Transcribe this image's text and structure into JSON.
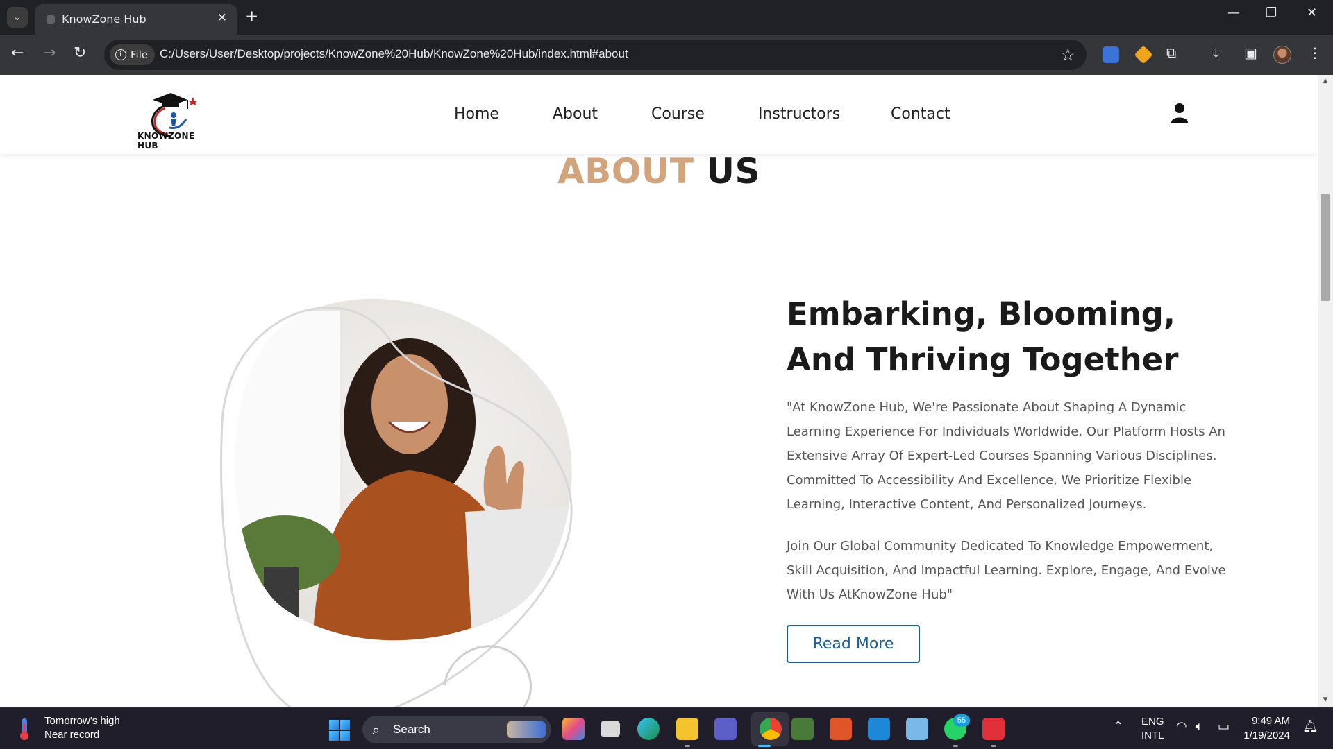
{
  "browser": {
    "tab_title": "KnowZone Hub",
    "chip_label": "File",
    "url": "C:/Users/User/Desktop/projects/KnowZone%20Hub/KnowZone%20Hub/index.html#about",
    "controls": {
      "minimize": "—",
      "maximize": "❐",
      "close": "✕",
      "new_tab": "+",
      "tab_close": "✕"
    }
  },
  "site": {
    "logo_text": "KNOWZONE HUB",
    "nav": [
      "Home",
      "About",
      "Course",
      "Instructors",
      "Contact"
    ],
    "icons": {
      "user": "user-icon"
    }
  },
  "about": {
    "title_accent": "ABOUT",
    "title_rest": "US",
    "accent_color": "#d2a47c",
    "headline": "Embarking, Blooming, And Thriving Together",
    "paragraph1": "\"At KnowZone Hub, We're Passionate About Shaping A Dynamic Learning Experience For Individuals Worldwide. Our Platform Hosts An Extensive Array Of Expert-Led Courses Spanning Various Disciplines. Committed To Accessibility And Excellence, We Prioritize Flexible Learning, Interactive Content, And Personalized Journeys.",
    "paragraph2": "Join Our Global Community Dedicated To Knowledge Empowerment, Skill Acquisition, And Impactful Learning. Explore, Engage, And Evolve With Us AtKnowZone Hub\"",
    "read_more": "Read More",
    "button_color": "#1b5f97"
  },
  "taskbar": {
    "weather_line1": "Tomorrow's high",
    "weather_line2": "Near record",
    "search_label": "Search",
    "whatsapp_badge": "55",
    "lang_line1": "ENG",
    "lang_line2": "INTL",
    "time": "9:49 AM",
    "date": "1/19/2024"
  }
}
